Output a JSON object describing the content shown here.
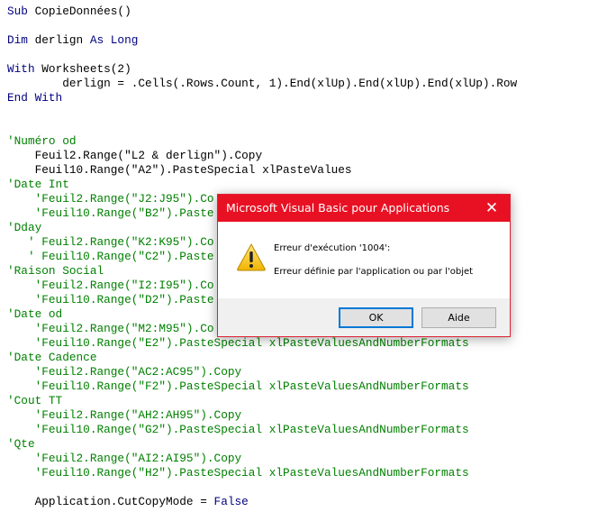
{
  "code_lines": [
    [
      {
        "k": "kw",
        "t": "Sub "
      },
      {
        "k": "tx",
        "t": "CopieDonnées()"
      }
    ],
    [],
    [
      {
        "k": "kw",
        "t": "Dim "
      },
      {
        "k": "tx",
        "t": "derlign "
      },
      {
        "k": "kw",
        "t": "As Long"
      }
    ],
    [],
    [
      {
        "k": "kw",
        "t": "With "
      },
      {
        "k": "tx",
        "t": "Worksheets(2)"
      }
    ],
    [
      {
        "k": "tx",
        "t": "        derlign = .Cells(.Rows.Count, 1).End(xlUp).End(xlUp).End(xlUp).Row"
      }
    ],
    [
      {
        "k": "kw",
        "t": "End With"
      }
    ],
    [],
    [],
    [
      {
        "k": "cm",
        "t": "'Numéro od"
      }
    ],
    [
      {
        "k": "tx",
        "t": "    Feuil2.Range(\"L2 & derlign\").Copy"
      }
    ],
    [
      {
        "k": "tx",
        "t": "    Feuil10.Range(\"A2\").PasteSpecial xlPasteValues"
      }
    ],
    [
      {
        "k": "cm",
        "t": "'Date Int"
      }
    ],
    [
      {
        "k": "cm",
        "t": "    'Feuil2.Range(\"J2:J95\").Co"
      }
    ],
    [
      {
        "k": "cm",
        "t": "    'Feuil10.Range(\"B2\").Paste"
      }
    ],
    [
      {
        "k": "cm",
        "t": "'Dday"
      }
    ],
    [
      {
        "k": "cm",
        "t": "   ' Feuil2.Range(\"K2:K95\").Co"
      }
    ],
    [
      {
        "k": "cm",
        "t": "   ' Feuil10.Range(\"C2\").Paste"
      }
    ],
    [
      {
        "k": "cm",
        "t": "'Raison Social"
      }
    ],
    [
      {
        "k": "cm",
        "t": "    'Feuil2.Range(\"I2:I95\").Co"
      }
    ],
    [
      {
        "k": "cm",
        "t": "    'Feuil10.Range(\"D2\").Paste"
      }
    ],
    [
      {
        "k": "cm",
        "t": "'Date od"
      }
    ],
    [
      {
        "k": "cm",
        "t": "    'Feuil2.Range(\"M2:M95\").Co"
      }
    ],
    [
      {
        "k": "cm",
        "t": "    'Feuil10.Range(\"E2\").PasteSpecial xlPasteValuesAndNumberFormats"
      }
    ],
    [
      {
        "k": "cm",
        "t": "'Date Cadence"
      }
    ],
    [
      {
        "k": "cm",
        "t": "    'Feuil2.Range(\"AC2:AC95\").Copy"
      }
    ],
    [
      {
        "k": "cm",
        "t": "    'Feuil10.Range(\"F2\").PasteSpecial xlPasteValuesAndNumberFormats"
      }
    ],
    [
      {
        "k": "cm",
        "t": "'Cout TT"
      }
    ],
    [
      {
        "k": "cm",
        "t": "    'Feuil2.Range(\"AH2:AH95\").Copy"
      }
    ],
    [
      {
        "k": "cm",
        "t": "    'Feuil10.Range(\"G2\").PasteSpecial xlPasteValuesAndNumberFormats"
      }
    ],
    [
      {
        "k": "cm",
        "t": "'Qte"
      }
    ],
    [
      {
        "k": "cm",
        "t": "    'Feuil2.Range(\"AI2:AI95\").Copy"
      }
    ],
    [
      {
        "k": "cm",
        "t": "    'Feuil10.Range(\"H2\").PasteSpecial xlPasteValuesAndNumberFormats"
      }
    ],
    [],
    [
      {
        "k": "tx",
        "t": "    Application.CutCopyMode = "
      },
      {
        "k": "kw",
        "t": "False"
      }
    ]
  ],
  "dialog": {
    "title": "Microsoft Visual Basic pour Applications",
    "close_glyph": "✕",
    "icon": "warning-icon",
    "message_line1": "Erreur d'exécution '1004':",
    "message_line2": "Erreur définie par l'application ou par l'objet",
    "ok_label": "OK",
    "help_label": "Aide",
    "title_color": "#E81123"
  },
  "colors": {
    "keyword": "#00007F",
    "comment": "#008000",
    "text": "#000000"
  }
}
